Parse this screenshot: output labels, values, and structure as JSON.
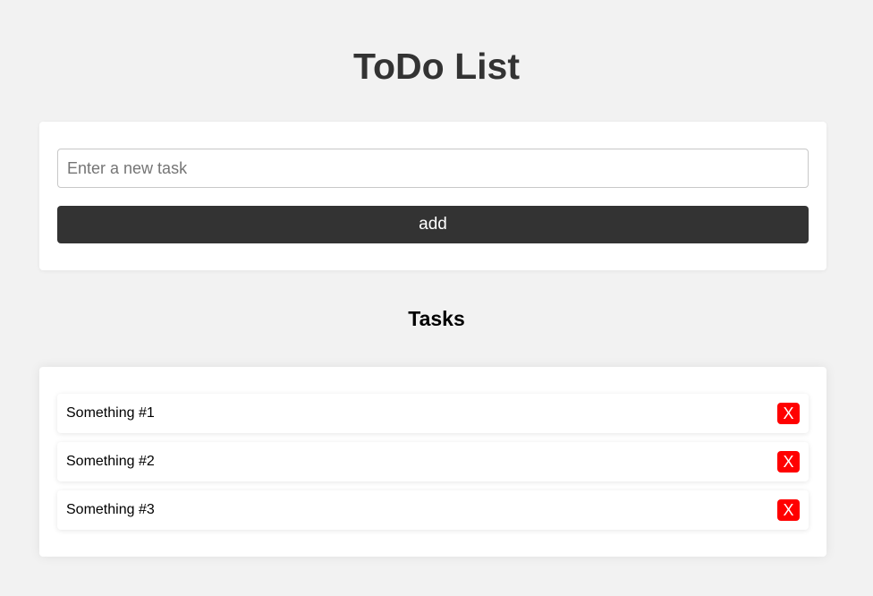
{
  "header": {
    "title": "ToDo List"
  },
  "form": {
    "placeholder": "Enter a new task",
    "value": "",
    "add_label": "add"
  },
  "tasks_section": {
    "heading": "Tasks",
    "items": [
      {
        "text": "Something #1",
        "delete_label": "X"
      },
      {
        "text": "Something #2",
        "delete_label": "X"
      },
      {
        "text": "Something #3",
        "delete_label": "X"
      }
    ]
  },
  "colors": {
    "background": "#f2f2f2",
    "card": "#ffffff",
    "add_button": "#333333",
    "delete_button": "#ff0000",
    "text": "#333333"
  }
}
